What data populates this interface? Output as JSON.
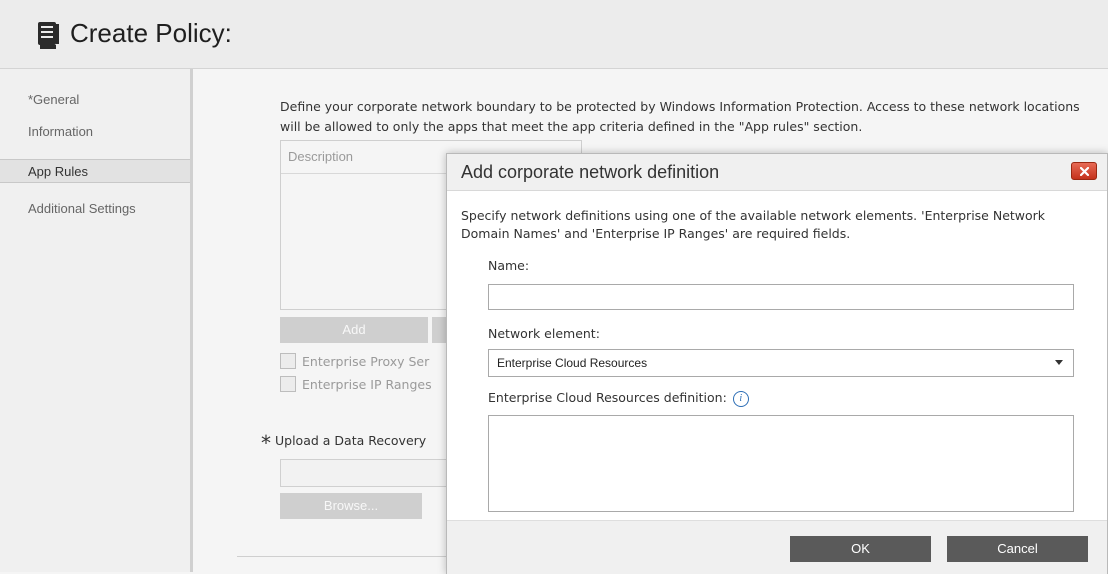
{
  "header": {
    "title": "Create Policy:",
    "icon": "document-icon"
  },
  "sidebar": {
    "general_line1": "*General",
    "general_line2": "Information",
    "app_rules": "App Rules",
    "additional": "Additional Settings"
  },
  "main": {
    "intro": "Define your corporate network boundary to be protected by Windows Information Protection. Access to these network locations will be allowed to only the apps that meet the app criteria defined in the \"App rules\" section.",
    "table_header": "Description",
    "add_label": "Add",
    "checkbox_proxy": "Enterprise Proxy Ser",
    "checkbox_ip": "Enterprise IP Ranges",
    "upload_star": "*",
    "upload_label": "Upload a Data Recovery",
    "browse_label": "Browse..."
  },
  "dialog": {
    "title": "Add corporate network definition",
    "description": "Specify network definitions using one of the available network elements. 'Enterprise Network Domain Names' and 'Enterprise IP Ranges' are required fields.",
    "name_label": "Name:",
    "name_value": "",
    "network_label": "Network element:",
    "network_selected": "Enterprise Cloud Resources",
    "definition_label": "Enterprise Cloud Resources definition:",
    "definition_value": "",
    "ok_label": "OK",
    "cancel_label": "Cancel"
  },
  "colors": {
    "close_button": "#d9412a",
    "dialog_button": "#5a5a5a",
    "info_icon": "#2e6fb6"
  }
}
